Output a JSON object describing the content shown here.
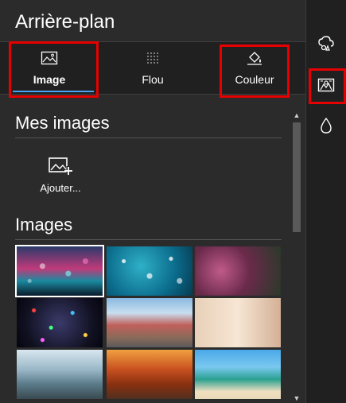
{
  "panel": {
    "title": "Arrière-plan"
  },
  "tabs": [
    {
      "label": "Image",
      "icon": "image-icon",
      "active": true
    },
    {
      "label": "Flou",
      "icon": "blur-icon",
      "active": false
    },
    {
      "label": "Couleur",
      "icon": "paint-bucket-icon",
      "active": false
    }
  ],
  "my_images": {
    "title": "Mes images",
    "add_label": "Ajouter..."
  },
  "images": {
    "title": "Images"
  },
  "sidebar": [
    {
      "icon": "effects-icon"
    },
    {
      "icon": "background-icon",
      "active": true
    },
    {
      "icon": "drop-icon"
    }
  ],
  "scrollbar": {
    "up": "▲",
    "down": "▼"
  },
  "colors": {
    "accent": "#4aa0f0",
    "highlight": "#e60000"
  }
}
